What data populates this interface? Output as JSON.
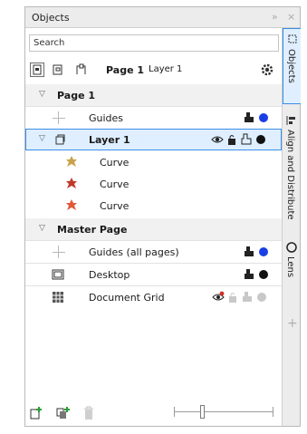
{
  "panel": {
    "title": "Objects",
    "title_icons": [
      "pin-icon",
      "close-icon"
    ],
    "close_glyph": "×",
    "pin_glyph": "»"
  },
  "search": {
    "placeholder": "Search",
    "value": ""
  },
  "toolbar": {
    "page_name": "Page 1",
    "layer_name": "Layer 1",
    "icons": [
      "view-page-layer-object-icon",
      "view-page-object-icon",
      "view-layer-object-icon",
      "gear-icon"
    ]
  },
  "tree": {
    "page1": {
      "label": "Page 1",
      "guides": {
        "label": "Guides"
      },
      "layer1": {
        "label": "Layer 1",
        "children": [
          {
            "label": "Curve",
            "color": "#c9a24a"
          },
          {
            "label": "Curve",
            "color": "#c0392b"
          },
          {
            "label": "Curve",
            "color": "#e05a3a"
          }
        ]
      }
    },
    "master": {
      "label": "Master Page",
      "guides_all": {
        "label": "Guides (all pages)"
      },
      "desktop": {
        "label": "Desktop"
      },
      "grid": {
        "label": "Document Grid"
      }
    }
  },
  "colors": {
    "blue_dot": "#1a3ee6",
    "black_dot": "#111111",
    "grey_dot": "#c8c8c8",
    "selection": "#3a8ee6"
  },
  "side_tabs": [
    {
      "label": "Objects",
      "active": true
    },
    {
      "label": "Align and Distribute",
      "active": false
    },
    {
      "label": "Lens",
      "active": false
    }
  ],
  "bottom": {
    "icons": [
      "new-layer-icon",
      "new-master-layer-icon",
      "delete-icon"
    ]
  }
}
